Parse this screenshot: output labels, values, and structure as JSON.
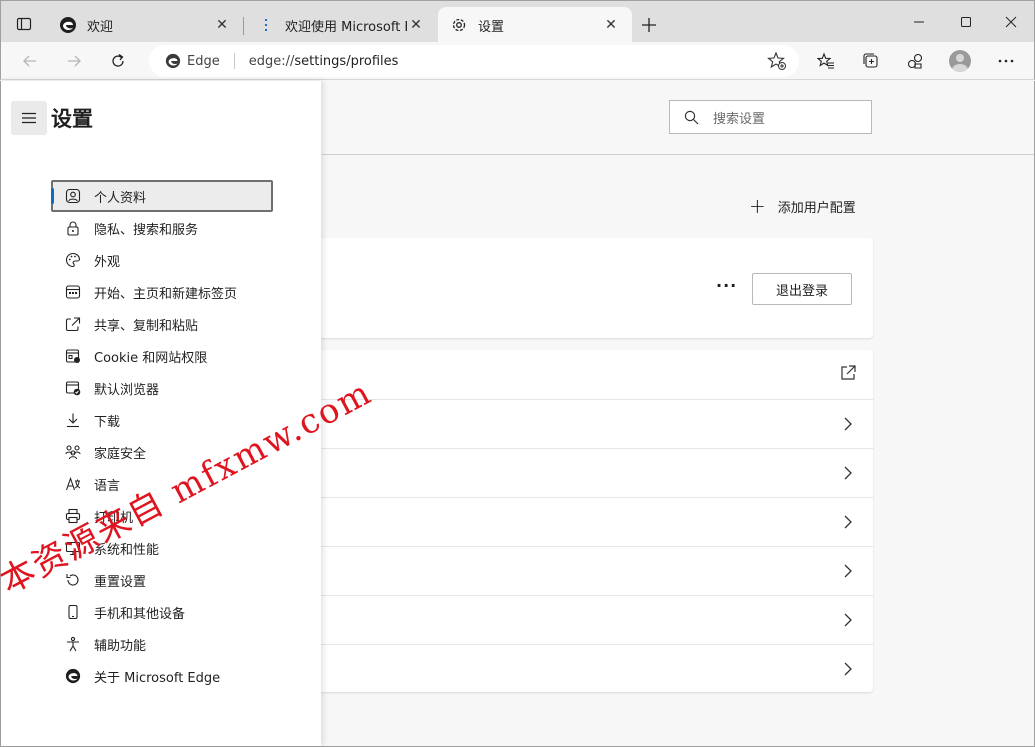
{
  "tabs": [
    {
      "label": "欢迎",
      "icon": "edge-logo-icon",
      "active": false
    },
    {
      "label": "欢迎使用 Microsoft Edge",
      "icon": "edge-doc-icon",
      "active": false
    },
    {
      "label": "设置",
      "icon": "gear-icon",
      "active": true
    }
  ],
  "address_bar": {
    "chip_label": "Edge",
    "url_prefix": "edge://",
    "url_path": "settings/profiles"
  },
  "header": {
    "search_placeholder": "搜索设置"
  },
  "profiles": {
    "add_profile_label": "添加用户配置",
    "more_label": "···",
    "signout_label": "退出登录"
  },
  "sidebar": {
    "title": "设置",
    "items": [
      {
        "label": "个人资料",
        "icon": "profile-icon",
        "selected": true
      },
      {
        "label": "隐私、搜索和服务",
        "icon": "lock-icon"
      },
      {
        "label": "外观",
        "icon": "palette-icon"
      },
      {
        "label": "开始、主页和新建标签页",
        "icon": "start-page-icon"
      },
      {
        "label": "共享、复制和粘贴",
        "icon": "share-icon"
      },
      {
        "label": "Cookie 和网站权限",
        "icon": "site-permissions-icon"
      },
      {
        "label": "默认浏览器",
        "icon": "default-browser-icon"
      },
      {
        "label": "下载",
        "icon": "download-icon"
      },
      {
        "label": "家庭安全",
        "icon": "family-icon"
      },
      {
        "label": "语言",
        "icon": "language-icon"
      },
      {
        "label": "打印机",
        "icon": "printer-icon"
      },
      {
        "label": "系统和性能",
        "icon": "system-icon"
      },
      {
        "label": "重置设置",
        "icon": "reset-icon"
      },
      {
        "label": "手机和其他设备",
        "icon": "phone-icon"
      },
      {
        "label": "辅助功能",
        "icon": "accessibility-icon"
      },
      {
        "label": "关于 Microsoft Edge",
        "icon": "edge-logo-icon"
      }
    ]
  },
  "watermark": "本资源来自 mfxmw.com",
  "colors": {
    "accent": "#0f6cbd",
    "watermark": "#e0141e"
  }
}
